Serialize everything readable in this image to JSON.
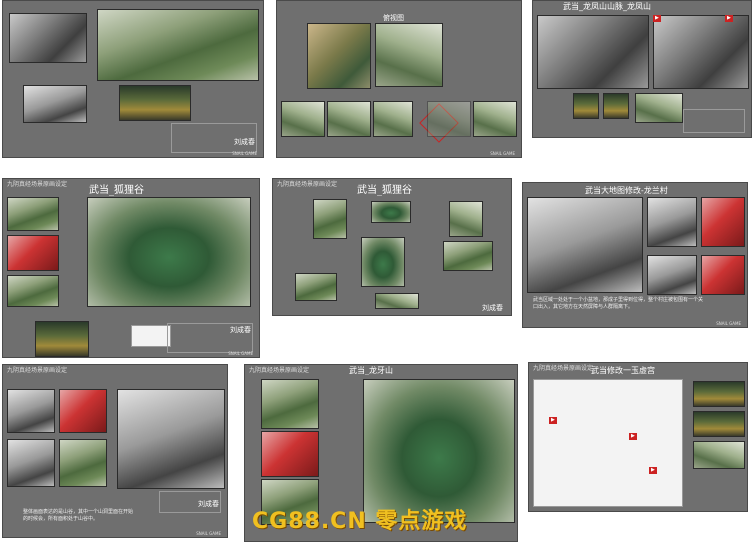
{
  "sheets": [
    {
      "id": "s1",
      "title": "",
      "sign": "刘成春"
    },
    {
      "id": "s2",
      "title": "",
      "caption": "俯视图"
    },
    {
      "id": "s3",
      "title": "武当_龙凤山山脉_龙凤山"
    },
    {
      "id": "s4",
      "header": "九阴真经场景原画设定",
      "title": "武当_狐狸谷",
      "sign": "刘成春"
    },
    {
      "id": "s5",
      "header": "九阴真经场景原画设定",
      "title": "武当_狐狸谷",
      "sign": "刘成春"
    },
    {
      "id": "s6",
      "header": "",
      "title": "武当大地图修改-龙兰村",
      "note": "武当区域一处处于一个小盆地，那成子里得到位得，整个村庄被包围有一个关口出入，其它地方在天然屏障与人群隔离下。"
    },
    {
      "id": "s7",
      "header": "九阴真经场景原画设定",
      "title": "",
      "sign": "刘成春",
      "note": "整体画面表达的是山谷，其中一个山洞里面在开始的时候会，所有面积处于山谷中。"
    },
    {
      "id": "s8",
      "header": "九阴真经场景原画设定",
      "title": "武当_龙牙山"
    },
    {
      "id": "s9",
      "header": "九阴真经场景原画设定",
      "title": "武当修改一玉虚宫"
    }
  ],
  "watermark": {
    "part1": "CG88.CN",
    "part2": "零点游戏"
  },
  "logo_text": "SNAIL GAME"
}
